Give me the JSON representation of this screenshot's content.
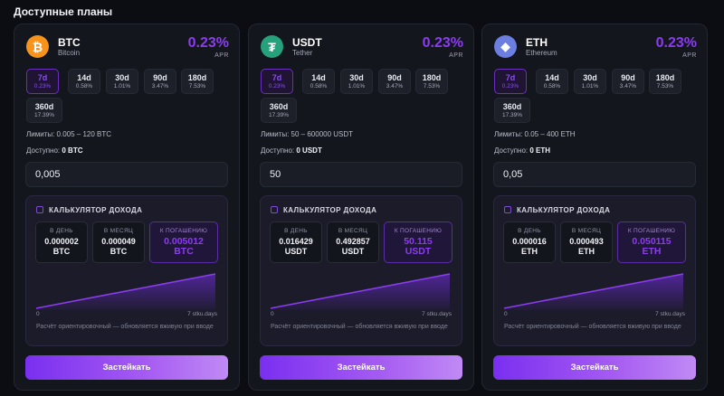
{
  "page_title": "Доступные планы",
  "plans": [
    {
      "symbol": "BTC",
      "name": "Bitcoin",
      "icon": "bitcoin-icon",
      "icon_glyph": "₿",
      "icon_color": "#f7931a",
      "apr": "0.23%",
      "apr_label": "APR",
      "terms": [
        {
          "days": "7d",
          "rate": "0.23%"
        },
        {
          "days": "14d",
          "rate": "0.58%"
        },
        {
          "days": "30d",
          "rate": "1.01%"
        },
        {
          "days": "90d",
          "rate": "3.47%"
        },
        {
          "days": "180d",
          "rate": "7.53%"
        },
        {
          "days": "360d",
          "rate": "17.39%"
        }
      ],
      "selected_term": "7d",
      "limits": "Лимиты: 0.005 – 120 BTC",
      "available_label": "Доступно:",
      "available_value": "0 BTC",
      "amount": "0,005",
      "calc": {
        "title": "КАЛЬКУЛЯТОР ДОХОДА",
        "per_day_label": "В ДЕНЬ",
        "per_day_value": "0.000002",
        "per_day_unit": "BTC",
        "per_month_label": "В МЕСЯЦ",
        "per_month_value": "0.000049",
        "per_month_unit": "BTC",
        "maturity_label": "К ПОГАШЕНИЮ",
        "maturity_value": "0.005012",
        "maturity_unit": "BTC",
        "axis_start": "0",
        "axis_end": "7 stku.days",
        "note": "Расчёт ориентировочный — обновляется вживую при вводе"
      },
      "button": "Застейкать"
    },
    {
      "symbol": "USDT",
      "name": "Tether",
      "icon": "tether-icon",
      "icon_glyph": "₮",
      "icon_color": "#26a17b",
      "apr": "0.23%",
      "apr_label": "APR",
      "terms": [
        {
          "days": "7d",
          "rate": "0.23%"
        },
        {
          "days": "14d",
          "rate": "0.58%"
        },
        {
          "days": "30d",
          "rate": "1.01%"
        },
        {
          "days": "90d",
          "rate": "3.47%"
        },
        {
          "days": "180d",
          "rate": "7.53%"
        },
        {
          "days": "360d",
          "rate": "17.39%"
        }
      ],
      "selected_term": "7d",
      "limits": "Лимиты: 50 – 600000 USDT",
      "available_label": "Доступно:",
      "available_value": "0 USDT",
      "amount": "50",
      "calc": {
        "title": "КАЛЬКУЛЯТОР ДОХОДА",
        "per_day_label": "В ДЕНЬ",
        "per_day_value": "0.016429",
        "per_day_unit": "USDT",
        "per_month_label": "В МЕСЯЦ",
        "per_month_value": "0.492857",
        "per_month_unit": "USDT",
        "maturity_label": "К ПОГАШЕНИЮ",
        "maturity_value": "50.115",
        "maturity_unit": "USDT",
        "axis_start": "0",
        "axis_end": "7 stku.days",
        "note": "Расчёт ориентировочный — обновляется вживую при вводе"
      },
      "button": "Застейкать"
    },
    {
      "symbol": "ETH",
      "name": "Ethereum",
      "icon": "ethereum-icon",
      "icon_glyph": "◆",
      "icon_color": "#6c7fe0",
      "apr": "0.23%",
      "apr_label": "APR",
      "terms": [
        {
          "days": "7d",
          "rate": "0.23%"
        },
        {
          "days": "14d",
          "rate": "0.58%"
        },
        {
          "days": "30d",
          "rate": "1.01%"
        },
        {
          "days": "90d",
          "rate": "3.47%"
        },
        {
          "days": "180d",
          "rate": "7.53%"
        },
        {
          "days": "360d",
          "rate": "17.39%"
        }
      ],
      "selected_term": "7d",
      "limits": "Лимиты: 0.05 – 400 ETH",
      "available_label": "Доступно:",
      "available_value": "0 ETH",
      "amount": "0,05",
      "calc": {
        "title": "КАЛЬКУЛЯТОР ДОХОДА",
        "per_day_label": "В ДЕНЬ",
        "per_day_value": "0.000016",
        "per_day_unit": "ETH",
        "per_month_label": "В МЕСЯЦ",
        "per_month_value": "0.000493",
        "per_month_unit": "ETH",
        "maturity_label": "К ПОГАШЕНИЮ",
        "maturity_value": "0.050115",
        "maturity_unit": "ETH",
        "axis_start": "0",
        "axis_end": "7 stku.days",
        "note": "Расчёт ориентировочный — обновляется вживую при вводе"
      },
      "button": "Застейкать"
    }
  ],
  "colors": {
    "accent": "#8b3cf0",
    "background": "#0c0d12",
    "card": "#14161e"
  }
}
